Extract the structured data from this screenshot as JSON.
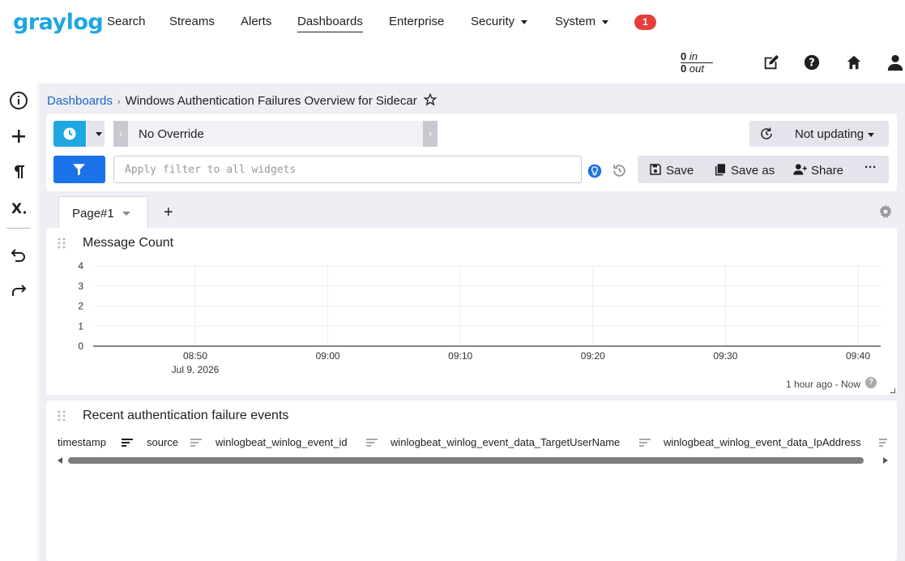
{
  "nav": {
    "logo": "graylog",
    "items": [
      {
        "label": "Search"
      },
      {
        "label": "Streams"
      },
      {
        "label": "Alerts"
      },
      {
        "label": "Dashboards",
        "active": true
      },
      {
        "label": "Enterprise"
      },
      {
        "label": "Security",
        "dropdown": true
      },
      {
        "label": "System",
        "dropdown": true
      }
    ],
    "notification_count": "1",
    "throughput": {
      "in_value": "0",
      "in_label": "in",
      "out_value": "0",
      "out_label": "out"
    },
    "icons": [
      "edit-icon",
      "help-icon",
      "home-icon",
      "user-icon"
    ]
  },
  "sidebar": {
    "icons": [
      "info-icon",
      "add-icon",
      "paragraph-icon",
      "parameters-icon",
      "undo-icon",
      "redo-icon"
    ]
  },
  "breadcrumb": {
    "root": "Dashboards",
    "current": "Windows Authentication Failures Overview for Sidecar"
  },
  "search": {
    "time_range": "No Override",
    "refresh_label": "Not updating",
    "query_placeholder": "Apply filter to all widgets",
    "query_value": "",
    "save_label": "Save",
    "save_as_label": "Save as",
    "share_label": "Share",
    "more_label": "···"
  },
  "tabs": {
    "pages": [
      {
        "label": "Page#1"
      }
    ],
    "add_label": "+"
  },
  "widgets": {
    "message_count": {
      "title": "Message Count",
      "time_range_label": "1 hour ago - Now",
      "help_label": "?"
    },
    "recent_events": {
      "title": "Recent authentication failure events",
      "columns": [
        "timestamp",
        "source",
        "winlogbeat_winlog_event_id",
        "winlogbeat_winlog_event_data_TargetUserName",
        "winlogbeat_winlog_event_data_IpAddress"
      ]
    }
  },
  "chart_data": {
    "type": "line",
    "title": "Message Count",
    "x_ticks": [
      "08:50",
      "09:00",
      "09:10",
      "09:20",
      "09:30",
      "09:40"
    ],
    "x_date_label": "Jul 9, 2026",
    "y_ticks": [
      0,
      1,
      2,
      3,
      4
    ],
    "ylim": [
      0,
      4
    ],
    "series": [
      {
        "values": [
          0,
          0,
          0,
          0,
          0,
          0
        ]
      }
    ],
    "grid": true,
    "legend": "none"
  }
}
